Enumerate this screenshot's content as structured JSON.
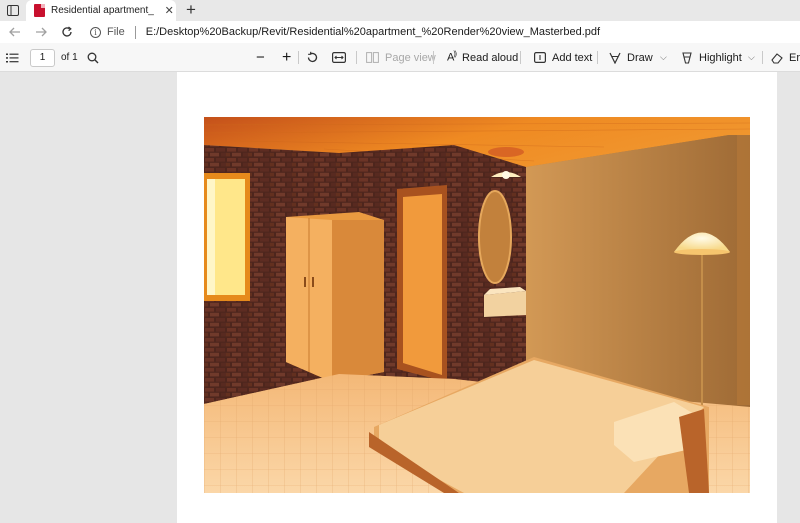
{
  "tab": {
    "title": "Residential apartment_ Render view_Masterbed.pdf",
    "close_glyph": "✕",
    "new_tab_glyph": "+"
  },
  "address_bar": {
    "back_icon": "back-arrow-icon",
    "forward_icon": "forward-arrow-icon",
    "refresh_icon": "refresh-icon",
    "scheme_label": "File",
    "url": "E:/Desktop%20Backup/Revit/Residential%20apartment_%20Render%20view_Masterbed.pdf"
  },
  "pdf_toolbar": {
    "page_number": "1",
    "page_total": "of 1",
    "zoom_out_glyph": "−",
    "zoom_in_glyph": "+",
    "page_view_label": "Page view",
    "read_aloud_label": "Read aloud",
    "add_text_label": "Add text",
    "draw_label": "Draw",
    "highlight_label": "Highlight",
    "erase_label": "Era"
  },
  "colors": {
    "ceiling": "#e8801e",
    "brick": "#5a2c22",
    "wardrobe": "#e8a24a",
    "floor": "#f7c98e",
    "wall_right": "#c28a48",
    "bed": "#f1c588"
  }
}
